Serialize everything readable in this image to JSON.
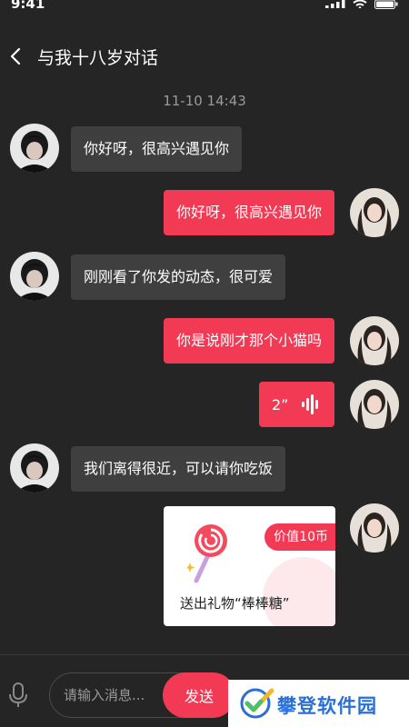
{
  "status_bar": {
    "time": "9:41",
    "icons": [
      "signal-icon",
      "wifi-icon",
      "battery-icon"
    ]
  },
  "header": {
    "back_icon": "chevron-left-icon",
    "title": "与我十八岁对话"
  },
  "chat": {
    "timestamp": "11-10  14:43",
    "messages": [
      {
        "side": "left",
        "type": "text",
        "text": "你好呀，很高兴遇见你"
      },
      {
        "side": "right",
        "type": "text",
        "text": "你好呀，很高兴遇见你"
      },
      {
        "side": "left",
        "type": "text",
        "text": "刚刚看了你发的动态，很可爱"
      },
      {
        "side": "right",
        "type": "text",
        "text": "你是说刚才那个小猫吗"
      },
      {
        "side": "right",
        "type": "voice",
        "duration": "2”"
      },
      {
        "side": "left",
        "type": "text",
        "text": "我们离得很近，可以请你吃饭"
      },
      {
        "side": "right",
        "type": "gift",
        "value_label": "价值10币",
        "text": "送出礼物“棒棒糖”"
      }
    ]
  },
  "input_bar": {
    "mic_icon": "microphone-icon",
    "placeholder": "请输入消息...",
    "send_label": "发送"
  },
  "watermark": {
    "text": "攀登软件园"
  },
  "colors": {
    "background": "#252525",
    "accent": "#f23a55",
    "bubble_received": "#3f3f3f",
    "timestamp": "#9a9a9a"
  }
}
